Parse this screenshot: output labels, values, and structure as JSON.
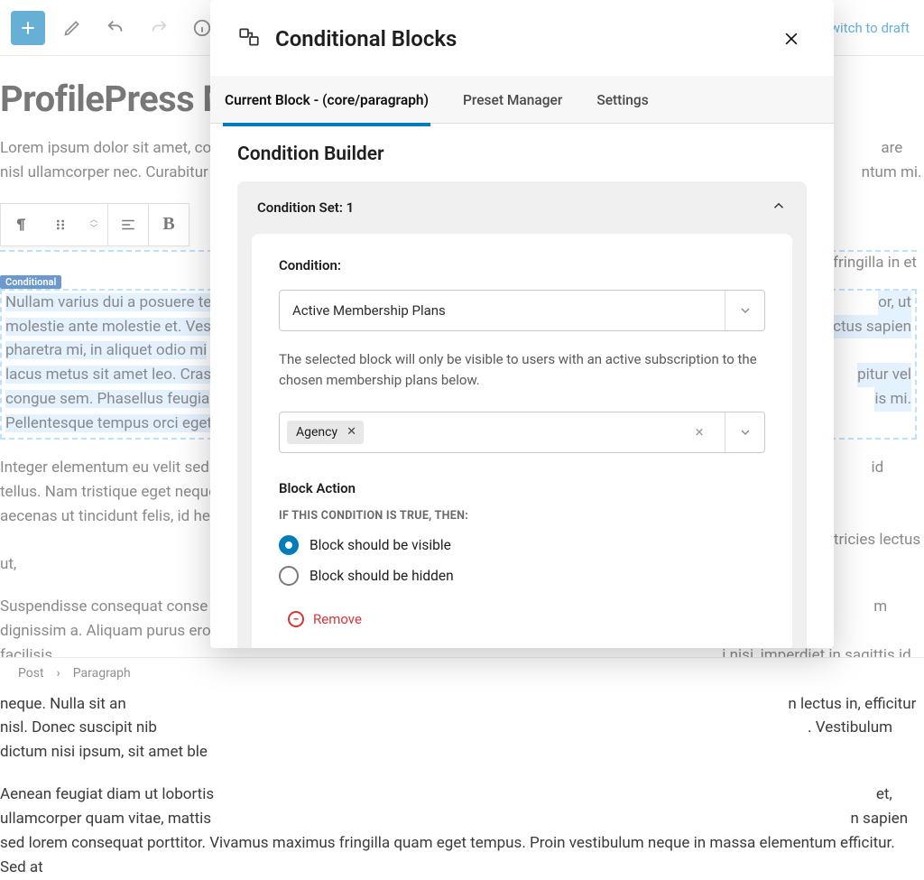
{
  "topbar": {
    "switch_draft": "Switch to draft"
  },
  "doc": {
    "title": "ProfilePress M",
    "p1": "Lorem ipsum dolor sit amet, co                                                                                                                                                                                are nisl ullamcorper nec. Curabitur con                                                                                                                                                                    ntum mi.",
    "p1_tail": "fringilla in et",
    "badge": "Conditional",
    "p2a": "Nullam varius dui a posuere te",
    "p2aT": "or, ut",
    "p2b": "molestie ante molestie et. Vest",
    "p2bT": "ctus sapien",
    "p2c": "pharetra mi, in aliquet odio mi",
    "p2d": "lacus metus sit amet leo. Cras",
    "p2dT": "pitur vel",
    "p2e": "congue sem. Phasellus feugia",
    "p2eT": "is mi.",
    "p2f": "Pellentesque tempus orci eget",
    "p3": "Integer elementum eu velit sed                                                                                                                                                                              id tellus. Nam tristique eget neque eget                                                                                                                                                                           aecenas ut tincidunt felis, id hendrerit mas                                                                                                                                                                         Aliquam a nisl malesuada, ultricies lectus ut,",
    "p4": "Suspendisse consequat conse                                                                                                                                                                               m dignissim a. Aliquam purus eros, facilisis                                                                                                                                                                                i nisi, imperdiet in sagittis id, facilisis                                                                                                                                                                                 stie nibh. Ut eget neque neque. Nulla sit an                                                                                                                                                                              n lectus in, efficitur nisl. Donec suscipit nib                                                                                                                                                                           . Vestibulum dictum nisi ipsum, sit amet ble",
    "p5": "Aenean feugiat diam ut lobortis                                                                                                                                                                              et, ullamcorper quam vitae, mattis                                                                                                                                                                        n sapien sed lorem consequat porttitor. Vivamus maximus fringilla quam eget tempus. Proin vestibulum neque in massa elementum efficitur. Sed at"
  },
  "toolbar": {
    "bold": "B"
  },
  "breadcrumb": {
    "root": "Post",
    "sep": "›",
    "leaf": "Paragraph"
  },
  "modal": {
    "title": "Conditional Blocks",
    "tabs": {
      "current": "Current Block - (core/paragraph)",
      "presets": "Preset Manager",
      "settings": "Settings"
    },
    "builder_title": "Condition Builder",
    "set_title": "Condition Set: 1",
    "condition_label": "Condition:",
    "condition_value": "Active Membership Plans",
    "help": "The selected block will only be visible to users with an active subscription to the chosen membership plans below.",
    "chip": "Agency",
    "block_action": "Block Action",
    "if_true": "IF THIS CONDITION IS TRUE, THEN:",
    "opt_visible": "Block should be visible",
    "opt_hidden": "Block should be hidden",
    "remove": "Remove"
  }
}
